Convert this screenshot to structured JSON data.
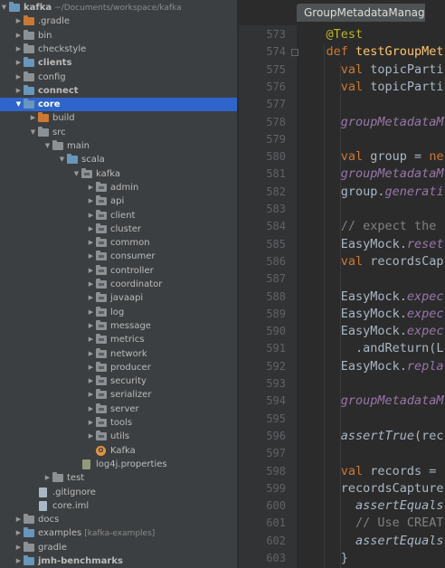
{
  "project": {
    "name": "kafka",
    "path": "~/Documents/workspace/kafka"
  },
  "tree": [
    {
      "label": "kafka",
      "suffix": "~/Documents/workspace/kafka",
      "depth": 0,
      "expand": "open",
      "icon": "folder-blue",
      "bold": true,
      "name": "tree-item-kafka"
    },
    {
      "label": ".gradle",
      "depth": 1,
      "expand": "closed",
      "icon": "folder-orange",
      "name": "tree-item-gradle-hidden"
    },
    {
      "label": "bin",
      "depth": 1,
      "expand": "closed",
      "icon": "folder",
      "name": "tree-item-bin"
    },
    {
      "label": "checkstyle",
      "depth": 1,
      "expand": "closed",
      "icon": "folder",
      "name": "tree-item-checkstyle"
    },
    {
      "label": "clients",
      "depth": 1,
      "expand": "closed",
      "icon": "folder-blue",
      "bold": true,
      "name": "tree-item-clients"
    },
    {
      "label": "config",
      "depth": 1,
      "expand": "closed",
      "icon": "folder",
      "name": "tree-item-config"
    },
    {
      "label": "connect",
      "depth": 1,
      "expand": "closed",
      "icon": "folder-blue",
      "bold": true,
      "name": "tree-item-connect"
    },
    {
      "label": "core",
      "depth": 1,
      "expand": "open",
      "icon": "folder-blue",
      "bold": true,
      "selected": true,
      "name": "tree-item-core"
    },
    {
      "label": "build",
      "depth": 2,
      "expand": "closed",
      "icon": "folder-orange",
      "name": "tree-item-build"
    },
    {
      "label": "src",
      "depth": 2,
      "expand": "open",
      "icon": "folder",
      "name": "tree-item-src"
    },
    {
      "label": "main",
      "depth": 3,
      "expand": "open",
      "icon": "folder",
      "name": "tree-item-main"
    },
    {
      "label": "scala",
      "depth": 4,
      "expand": "open",
      "icon": "folder-blue",
      "name": "tree-item-scala"
    },
    {
      "label": "kafka",
      "depth": 5,
      "expand": "open",
      "icon": "package",
      "name": "tree-item-kafka-package"
    },
    {
      "label": "admin",
      "depth": 6,
      "expand": "closed",
      "icon": "package",
      "name": "tree-item-admin"
    },
    {
      "label": "api",
      "depth": 6,
      "expand": "closed",
      "icon": "package",
      "name": "tree-item-api"
    },
    {
      "label": "client",
      "depth": 6,
      "expand": "closed",
      "icon": "package",
      "name": "tree-item-client"
    },
    {
      "label": "cluster",
      "depth": 6,
      "expand": "closed",
      "icon": "package",
      "name": "tree-item-cluster"
    },
    {
      "label": "common",
      "depth": 6,
      "expand": "closed",
      "icon": "package",
      "name": "tree-item-common"
    },
    {
      "label": "consumer",
      "depth": 6,
      "expand": "closed",
      "icon": "package",
      "name": "tree-item-consumer"
    },
    {
      "label": "controller",
      "depth": 6,
      "expand": "closed",
      "icon": "package",
      "name": "tree-item-controller"
    },
    {
      "label": "coordinator",
      "depth": 6,
      "expand": "closed",
      "icon": "package",
      "name": "tree-item-coordinator"
    },
    {
      "label": "javaapi",
      "depth": 6,
      "expand": "closed",
      "icon": "package",
      "name": "tree-item-javaapi"
    },
    {
      "label": "log",
      "depth": 6,
      "expand": "closed",
      "icon": "package",
      "name": "tree-item-log"
    },
    {
      "label": "message",
      "depth": 6,
      "expand": "closed",
      "icon": "package",
      "name": "tree-item-message"
    },
    {
      "label": "metrics",
      "depth": 6,
      "expand": "closed",
      "icon": "package",
      "name": "tree-item-metrics"
    },
    {
      "label": "network",
      "depth": 6,
      "expand": "closed",
      "icon": "package",
      "name": "tree-item-network"
    },
    {
      "label": "producer",
      "depth": 6,
      "expand": "closed",
      "icon": "package",
      "name": "tree-item-producer"
    },
    {
      "label": "security",
      "depth": 6,
      "expand": "closed",
      "icon": "package",
      "name": "tree-item-security"
    },
    {
      "label": "serializer",
      "depth": 6,
      "expand": "closed",
      "icon": "package",
      "name": "tree-item-serializer"
    },
    {
      "label": "server",
      "depth": 6,
      "expand": "closed",
      "icon": "package",
      "name": "tree-item-server"
    },
    {
      "label": "tools",
      "depth": 6,
      "expand": "closed",
      "icon": "package",
      "name": "tree-item-tools"
    },
    {
      "label": "utils",
      "depth": 6,
      "expand": "closed",
      "icon": "package",
      "name": "tree-item-utils"
    },
    {
      "label": "Kafka",
      "depth": 6,
      "expand": "none",
      "icon": "scala-object",
      "name": "tree-item-kafka-object"
    },
    {
      "label": "log4j.properties",
      "depth": 5,
      "expand": "none",
      "icon": "properties-file",
      "name": "tree-item-log4j-properties"
    },
    {
      "label": "test",
      "depth": 3,
      "expand": "closed",
      "icon": "folder",
      "name": "tree-item-test"
    },
    {
      "label": ".gitignore",
      "depth": 2,
      "expand": "none",
      "icon": "file",
      "name": "tree-item-gitignore"
    },
    {
      "label": "core.iml",
      "depth": 2,
      "expand": "none",
      "icon": "file",
      "name": "tree-item-core-iml"
    },
    {
      "label": "docs",
      "depth": 1,
      "expand": "closed",
      "icon": "folder",
      "name": "tree-item-docs"
    },
    {
      "label": "examples",
      "suffix": "[kafka-examples]",
      "depth": 1,
      "expand": "closed",
      "icon": "folder-blue",
      "name": "tree-item-examples"
    },
    {
      "label": "gradle",
      "depth": 1,
      "expand": "closed",
      "icon": "folder",
      "name": "tree-item-gradle"
    },
    {
      "label": "jmh-benchmarks",
      "depth": 1,
      "expand": "closed",
      "icon": "folder-blue",
      "bold": true,
      "name": "tree-item-jmh-benchmarks"
    }
  ],
  "editor": {
    "tab_title": "GroupMetadataManag",
    "lines": [
      {
        "n": "573",
        "parts": [
          [
            "annot",
            "    @Test"
          ]
        ]
      },
      {
        "n": "574",
        "parts": [
          [
            "kw",
            "    def "
          ],
          [
            "fn",
            "testGroupMet"
          ]
        ]
      },
      {
        "n": "575",
        "parts": [
          [
            "kw",
            "      val "
          ],
          [
            "t",
            "topicParti"
          ]
        ]
      },
      {
        "n": "576",
        "parts": [
          [
            "kw",
            "      val "
          ],
          [
            "t",
            "topicParti"
          ]
        ]
      },
      {
        "n": "577",
        "parts": []
      },
      {
        "n": "578",
        "parts": [
          [
            "it",
            "      groupMetadataM"
          ]
        ]
      },
      {
        "n": "579",
        "parts": []
      },
      {
        "n": "580",
        "parts": [
          [
            "kw",
            "      val "
          ],
          [
            "t",
            "group = "
          ],
          [
            "kw",
            "ne"
          ]
        ]
      },
      {
        "n": "581",
        "parts": [
          [
            "it",
            "      groupMetadataM"
          ]
        ]
      },
      {
        "n": "582",
        "parts": [
          [
            "t",
            "      group."
          ],
          [
            "it",
            "generati"
          ]
        ]
      },
      {
        "n": "583",
        "parts": []
      },
      {
        "n": "584",
        "parts": [
          [
            "cm",
            "      // expect the "
          ]
        ]
      },
      {
        "n": "585",
        "parts": [
          [
            "t",
            "      EasyMock."
          ],
          [
            "it",
            "reset"
          ]
        ]
      },
      {
        "n": "586",
        "parts": [
          [
            "kw",
            "      val "
          ],
          [
            "t",
            "recordsCap"
          ]
        ]
      },
      {
        "n": "587",
        "parts": []
      },
      {
        "n": "588",
        "parts": [
          [
            "t",
            "      EasyMock."
          ],
          [
            "it",
            "expec"
          ]
        ]
      },
      {
        "n": "589",
        "parts": [
          [
            "t",
            "      EasyMock."
          ],
          [
            "it",
            "expec"
          ]
        ]
      },
      {
        "n": "590",
        "parts": [
          [
            "t",
            "      EasyMock."
          ],
          [
            "it",
            "expec"
          ]
        ]
      },
      {
        "n": "591",
        "parts": [
          [
            "t",
            "        .andReturn(L"
          ]
        ]
      },
      {
        "n": "592",
        "parts": [
          [
            "t",
            "      EasyMock."
          ],
          [
            "it",
            "repla"
          ]
        ]
      },
      {
        "n": "593",
        "parts": []
      },
      {
        "n": "594",
        "parts": [
          [
            "it",
            "      groupMetadataM"
          ]
        ]
      },
      {
        "n": "595",
        "parts": []
      },
      {
        "n": "596",
        "parts": [
          [
            "itw",
            "      assertTrue"
          ],
          [
            "t",
            "(rec"
          ]
        ]
      },
      {
        "n": "597",
        "parts": []
      },
      {
        "n": "598",
        "parts": [
          [
            "kw",
            "      val "
          ],
          [
            "t",
            "records = "
          ]
        ]
      },
      {
        "n": "599",
        "parts": [
          [
            "t",
            "      recordsCapture"
          ]
        ]
      },
      {
        "n": "600",
        "parts": [
          [
            "itw",
            "        assertEquals"
          ]
        ]
      },
      {
        "n": "601",
        "parts": [
          [
            "cm",
            "        // Use CREAT"
          ]
        ]
      },
      {
        "n": "602",
        "parts": [
          [
            "itw",
            "        assertEquals"
          ]
        ]
      },
      {
        "n": "603",
        "parts": [
          [
            "t",
            "      }"
          ]
        ]
      }
    ]
  }
}
